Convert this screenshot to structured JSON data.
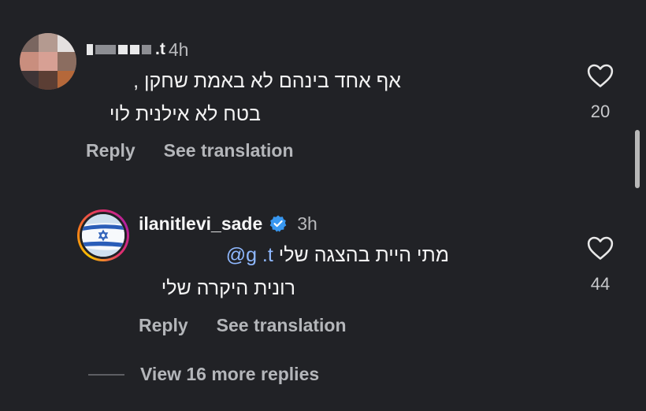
{
  "comments": [
    {
      "username_visible": ".t",
      "time": "4h",
      "lines": [
        "אף אחד בינהם לא באמת שחקן ,",
        "בטח לא אילנית לוי"
      ],
      "likes": "20",
      "reply_label": "Reply",
      "translate_label": "See translation"
    }
  ],
  "reply": {
    "username": "ilanitlevi_sade",
    "verified": true,
    "time": "3h",
    "line1_text": "מתי היית בהצגה שלי",
    "mention_visible": "@g   .t",
    "line2": "רונית היקרה שלי",
    "likes": "44",
    "reply_label": "Reply",
    "translate_label": "See translation"
  },
  "more_replies_label": "View 16 more replies",
  "icons": {
    "like": "heart-outline-icon",
    "verified": "verified-badge-icon",
    "flag": "israel-flag-icon"
  },
  "colors": {
    "background": "#212226",
    "text": "#f5f5f5",
    "muted": "#b4b6ba",
    "verified": "#3897f0",
    "mention": "#8fb8ff"
  }
}
